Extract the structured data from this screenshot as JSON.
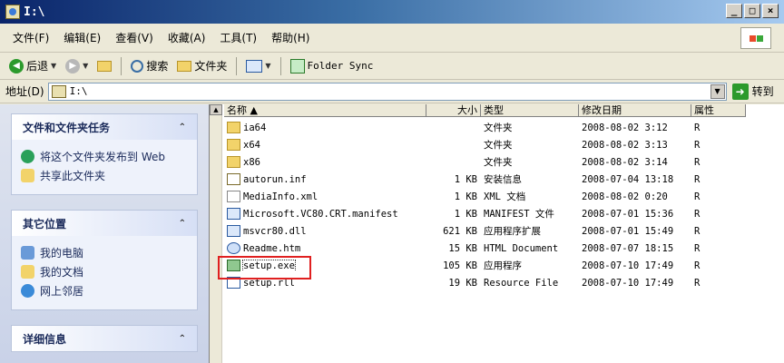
{
  "window": {
    "title": "I:\\",
    "buttons": [
      "_",
      "□",
      "×"
    ]
  },
  "menu": [
    "文件(F)",
    "编辑(E)",
    "查看(V)",
    "收藏(A)",
    "工具(T)",
    "帮助(H)"
  ],
  "toolbar": {
    "back": "后退",
    "search": "搜索",
    "folders": "文件夹",
    "folder_sync": "Folder Sync"
  },
  "address": {
    "label": "地址(D)",
    "value": "I:\\",
    "go": "转到"
  },
  "taskpane": {
    "groups": [
      {
        "title": "文件和文件夹任务",
        "links": [
          "将这个文件夹发布到 Web",
          "共享此文件夹"
        ]
      },
      {
        "title": "其它位置",
        "links": [
          "我的电脑",
          "我的文档",
          "网上邻居"
        ]
      },
      {
        "title": "详细信息",
        "links": []
      }
    ]
  },
  "columns": [
    "名称",
    "大小",
    "类型",
    "修改日期",
    "属性"
  ],
  "files": [
    {
      "name": "ia64",
      "size": "",
      "type": "文件夹",
      "date": "2008-08-02 3:12",
      "attr": "R",
      "icon": "folder-icon"
    },
    {
      "name": "x64",
      "size": "",
      "type": "文件夹",
      "date": "2008-08-02 3:13",
      "attr": "R",
      "icon": "folder-icon"
    },
    {
      "name": "x86",
      "size": "",
      "type": "文件夹",
      "date": "2008-08-02 3:14",
      "attr": "R",
      "icon": "folder-icon"
    },
    {
      "name": "autorun.inf",
      "size": "1 KB",
      "type": "安装信息",
      "date": "2008-07-04 13:18",
      "attr": "R",
      "icon": "setup-info-icon"
    },
    {
      "name": "MediaInfo.xml",
      "size": "1 KB",
      "type": "XML 文档",
      "date": "2008-08-02 0:20",
      "attr": "R",
      "icon": "xml-file-icon"
    },
    {
      "name": "Microsoft.VC80.CRT.manifest",
      "size": "1 KB",
      "type": "MANIFEST 文件",
      "date": "2008-07-01 15:36",
      "attr": "R",
      "icon": "manifest-file-icon"
    },
    {
      "name": "msvcr80.dll",
      "size": "621 KB",
      "type": "应用程序扩展",
      "date": "2008-07-01 15:49",
      "attr": "R",
      "icon": "dll-file-icon"
    },
    {
      "name": "Readme.htm",
      "size": "15 KB",
      "type": "HTML Document",
      "date": "2008-07-07 18:15",
      "attr": "R",
      "icon": "html-file-icon"
    },
    {
      "name": "setup.exe",
      "size": "105 KB",
      "type": "应用程序",
      "date": "2008-07-10 17:49",
      "attr": "R",
      "icon": "exe-file-icon"
    },
    {
      "name": "setup.rll",
      "size": "19 KB",
      "type": "Resource File",
      "date": "2008-07-10 17:49",
      "attr": "R",
      "icon": "resource-file-icon"
    }
  ],
  "colors": {
    "title_start": "#0a246a",
    "title_end": "#a6caf0",
    "highlight": "#e02020"
  }
}
